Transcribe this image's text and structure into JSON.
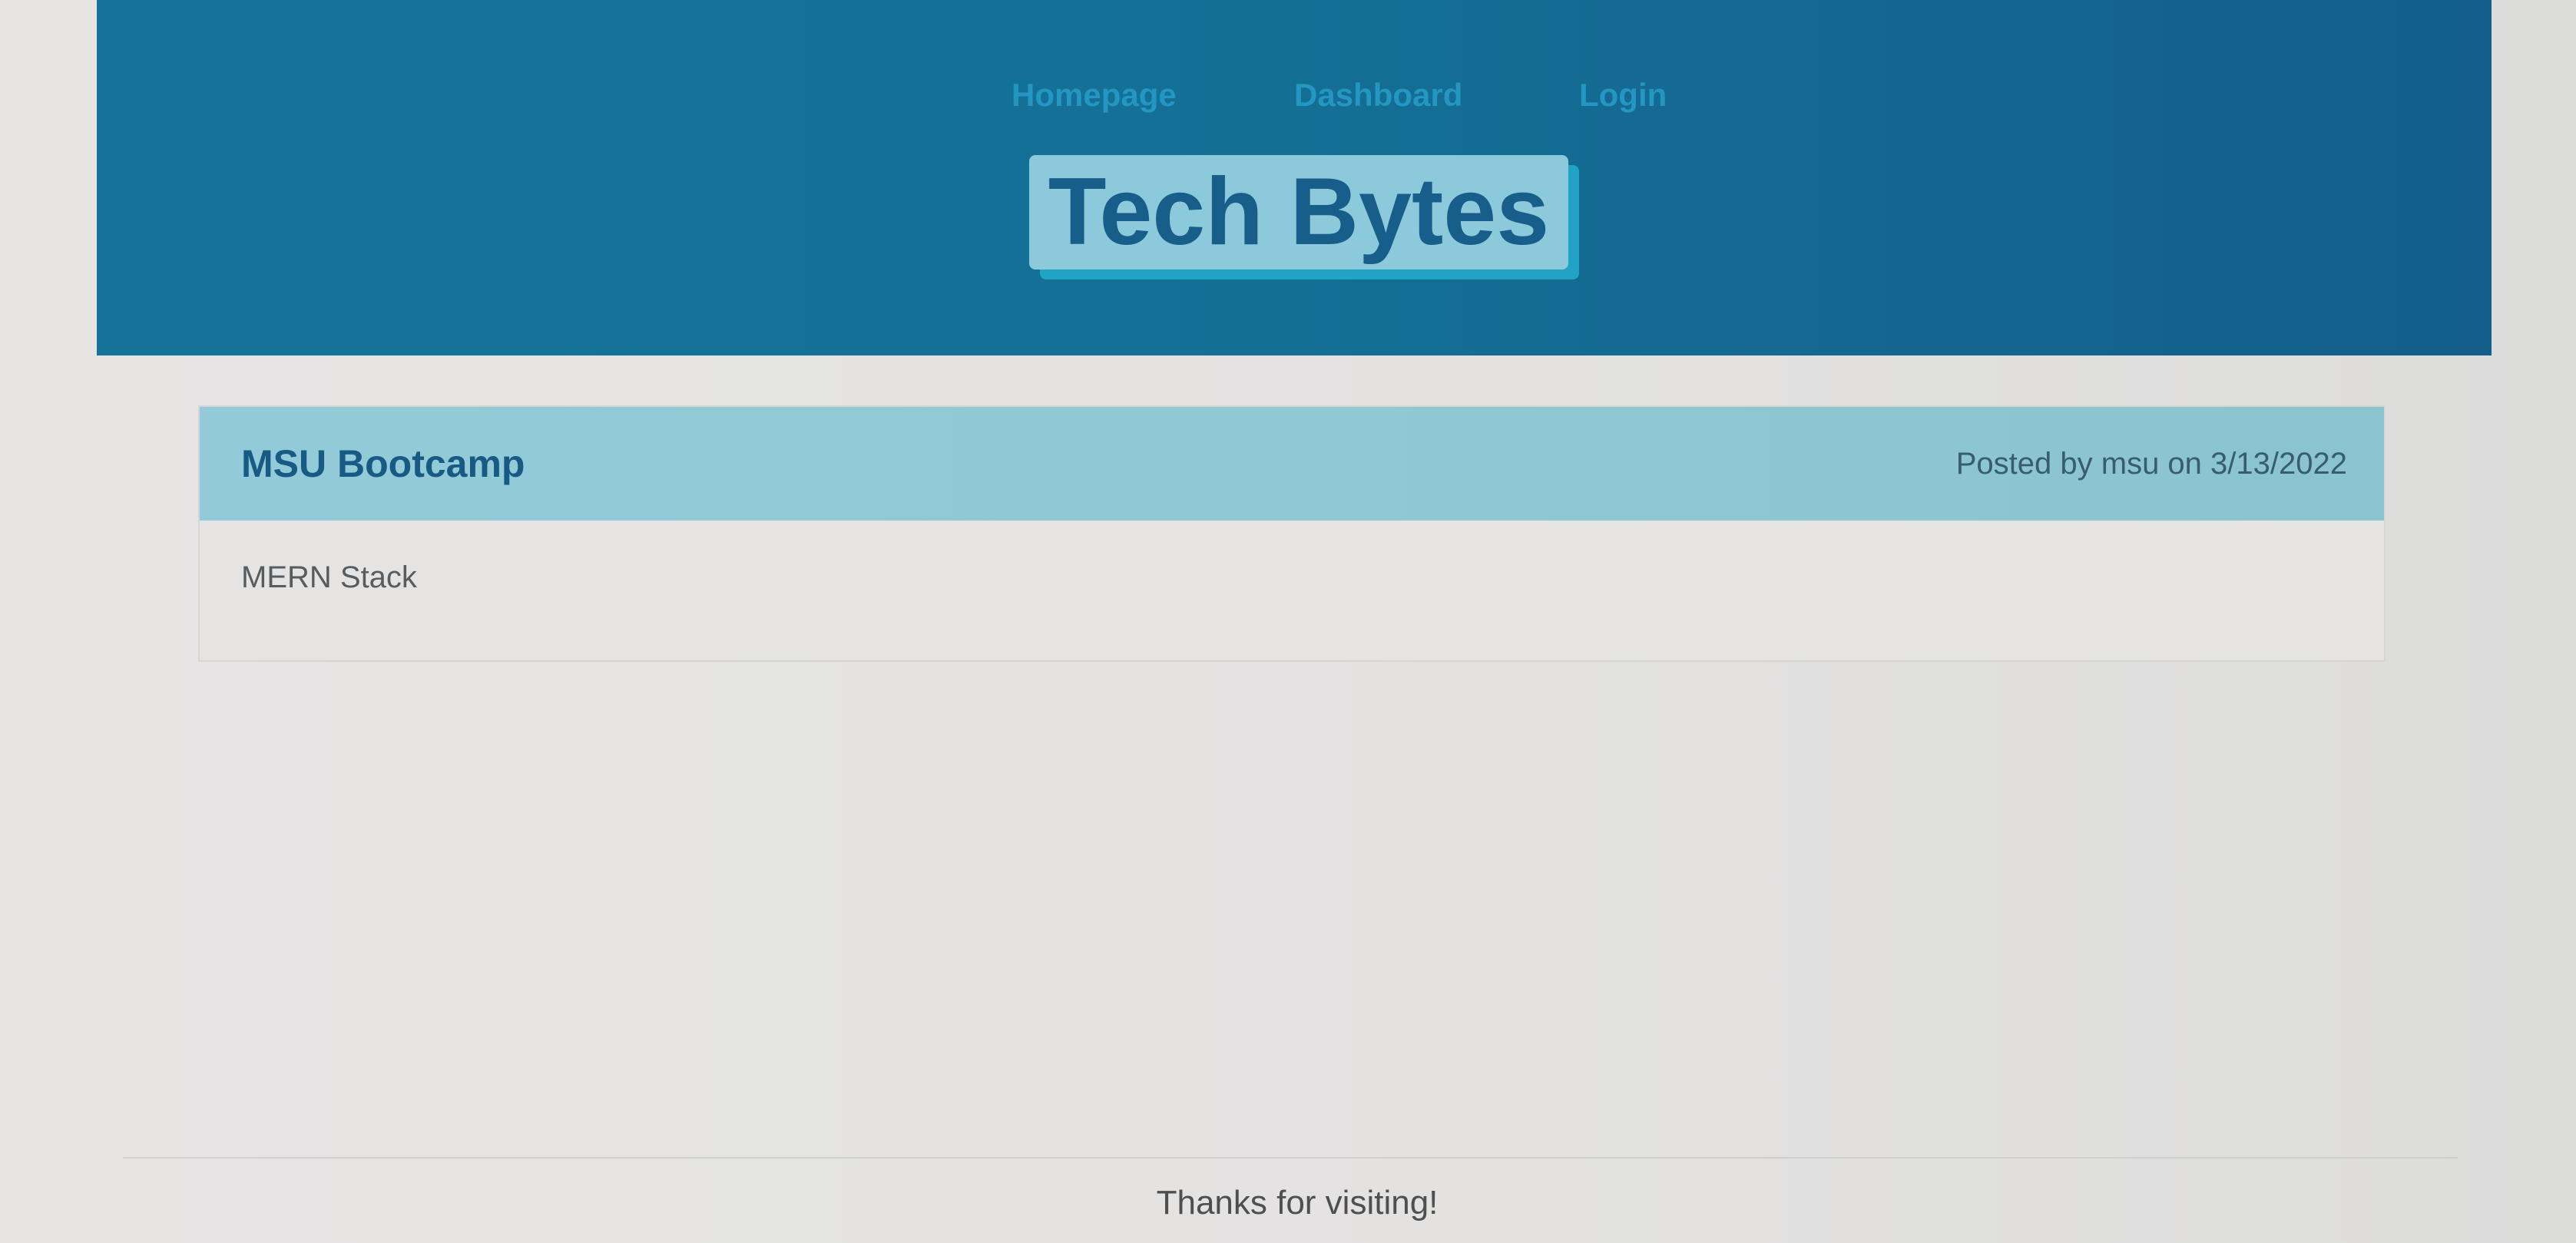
{
  "header": {
    "nav": {
      "homepage": "Homepage",
      "dashboard": "Dashboard",
      "login": "Login"
    },
    "brand": "Tech Bytes",
    "bg_color": "#146f95",
    "nav_color": "#2397c1",
    "brand_bg_color": "#8cc9da",
    "brand_text_color": "#175e8a"
  },
  "post": {
    "title": "MSU Bootcamp",
    "meta": "Posted by msu on 3/13/2022",
    "body": "MERN Stack",
    "header_color": "#92cad9"
  },
  "footer": {
    "text": "Thanks for visiting!"
  }
}
